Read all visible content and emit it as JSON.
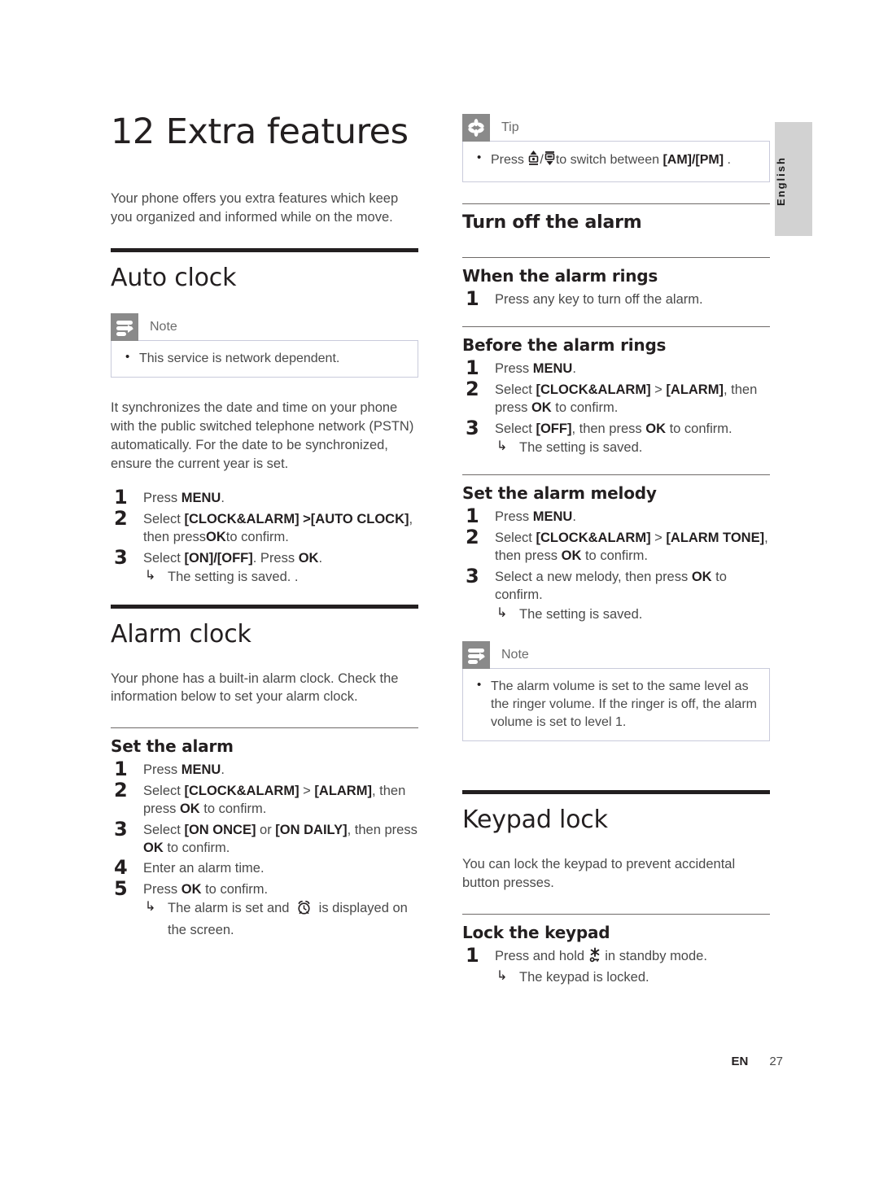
{
  "page": {
    "language_tab": "English",
    "footer_locale": "EN",
    "footer_page_number": "27"
  },
  "chapter": {
    "number": "12",
    "title": "Extra features",
    "intro": "Your phone offers you extra features which keep you organized and informed while on the move."
  },
  "left_column": {
    "auto_clock": {
      "heading": "Auto clock",
      "note": {
        "icon": "note-icon",
        "label": "Note",
        "items": [
          "This service is network dependent."
        ]
      },
      "paragraph": "It synchronizes the date and time on your phone with the public switched telephone network (PSTN) automatically. For the date to be synchronized, ensure the current year is set.",
      "steps": [
        {
          "parts": [
            {
              "t": "Press ",
              "b": false
            },
            {
              "t": "MENU",
              "b": true
            },
            {
              "t": ".",
              "b": false
            }
          ]
        },
        {
          "parts": [
            {
              "t": "Select ",
              "b": false
            },
            {
              "t": "[CLOCK&ALARM] >[AUTO CLOCK]",
              "b": true
            },
            {
              "t": ", then press",
              "b": false
            },
            {
              "t": "OK",
              "b": true
            },
            {
              "t": "to confirm.",
              "b": false
            }
          ]
        },
        {
          "parts": [
            {
              "t": "Select ",
              "b": false
            },
            {
              "t": "[ON]/[OFF]",
              "b": true
            },
            {
              "t": ". Press ",
              "b": false
            },
            {
              "t": "OK",
              "b": true
            },
            {
              "t": ".",
              "b": false
            }
          ],
          "result": "The setting is saved. ."
        }
      ]
    },
    "alarm_clock": {
      "heading": "Alarm clock",
      "paragraph": "Your phone has a built-in alarm clock. Check the information below to set your alarm clock.",
      "set_the_alarm": {
        "heading": "Set the alarm",
        "steps": [
          {
            "parts": [
              {
                "t": "Press ",
                "b": false
              },
              {
                "t": "MENU",
                "b": true
              },
              {
                "t": ".",
                "b": false
              }
            ]
          },
          {
            "parts": [
              {
                "t": "Select ",
                "b": false
              },
              {
                "t": "[CLOCK&ALARM]",
                "b": true
              },
              {
                "t": " > ",
                "b": false
              },
              {
                "t": "[ALARM]",
                "b": true
              },
              {
                "t": ", then press ",
                "b": false
              },
              {
                "t": "OK",
                "b": true
              },
              {
                "t": " to confirm.",
                "b": false
              }
            ]
          },
          {
            "parts": [
              {
                "t": "Select ",
                "b": false
              },
              {
                "t": "[ON ONCE]",
                "b": true
              },
              {
                "t": " or ",
                "b": false
              },
              {
                "t": "[ON DAILY]",
                "b": true
              },
              {
                "t": ", then press ",
                "b": false
              },
              {
                "t": "OK",
                "b": true
              },
              {
                "t": " to confirm.",
                "b": false
              }
            ]
          },
          {
            "parts": [
              {
                "t": "Enter an alarm time.",
                "b": false
              }
            ]
          },
          {
            "parts": [
              {
                "t": "Press ",
                "b": false
              },
              {
                "t": "OK",
                "b": true
              },
              {
                "t": " to confirm.",
                "b": false
              }
            ],
            "result_pre": "The alarm is set and",
            "result_icon": "alarm-clock-icon",
            "result_post": "is displayed on the screen."
          }
        ]
      }
    }
  },
  "right_column": {
    "tip": {
      "icon": "tip-asterisk-icon",
      "label": "Tip",
      "item_pre": "Press",
      "item_icon_up": "nav-up-key-icon",
      "item_sep": "/",
      "item_icon_down": "nav-down-key-icon",
      "item_mid": "to switch between ",
      "item_bold": "[AM]/[PM]",
      "item_post": " ."
    },
    "turn_off_the_alarm": {
      "heading": "Turn off the alarm",
      "when_the_alarm_rings": {
        "heading": "When the alarm rings",
        "steps": [
          {
            "parts": [
              {
                "t": "Press any key to turn off the alarm.",
                "b": false
              }
            ]
          }
        ]
      },
      "before_the_alarm_rings": {
        "heading": "Before the alarm rings",
        "steps": [
          {
            "parts": [
              {
                "t": "Press ",
                "b": false
              },
              {
                "t": "MENU",
                "b": true
              },
              {
                "t": ".",
                "b": false
              }
            ]
          },
          {
            "parts": [
              {
                "t": "Select ",
                "b": false
              },
              {
                "t": "[CLOCK&ALARM]",
                "b": true
              },
              {
                "t": " > ",
                "b": false
              },
              {
                "t": "[ALARM]",
                "b": true
              },
              {
                "t": ", then press ",
                "b": false
              },
              {
                "t": "OK",
                "b": true
              },
              {
                "t": " to confirm.",
                "b": false
              }
            ]
          },
          {
            "parts": [
              {
                "t": "Select ",
                "b": false
              },
              {
                "t": "[OFF]",
                "b": true
              },
              {
                "t": ", then press ",
                "b": false
              },
              {
                "t": "OK",
                "b": true
              },
              {
                "t": " to confirm.",
                "b": false
              }
            ],
            "result": "The setting is saved."
          }
        ]
      },
      "set_the_alarm_melody": {
        "heading": "Set the alarm melody",
        "steps": [
          {
            "parts": [
              {
                "t": "Press ",
                "b": false
              },
              {
                "t": "MENU",
                "b": true
              },
              {
                "t": ".",
                "b": false
              }
            ]
          },
          {
            "parts": [
              {
                "t": "Select ",
                "b": false
              },
              {
                "t": "[CLOCK&ALARM]",
                "b": true
              },
              {
                "t": " > ",
                "b": false
              },
              {
                "t": "[ALARM TONE]",
                "b": true
              },
              {
                "t": ", then press ",
                "b": false
              },
              {
                "t": "OK",
                "b": true
              },
              {
                "t": " to confirm.",
                "b": false
              }
            ]
          },
          {
            "parts": [
              {
                "t": "Select a new melody, then press ",
                "b": false
              },
              {
                "t": "OK",
                "b": true
              },
              {
                "t": " to confirm.",
                "b": false
              }
            ],
            "result": "The setting is saved."
          }
        ]
      },
      "note": {
        "icon": "note-icon",
        "label": "Note",
        "items": [
          "The alarm volume is set to the same level as the ringer volume. If the ringer is off, the alarm volume is set to level 1."
        ]
      }
    },
    "keypad_lock": {
      "heading": "Keypad lock",
      "paragraph": "You can lock the keypad to prevent accidental button presses.",
      "lock_the_keypad": {
        "heading": "Lock the keypad",
        "step_pre": "Press and hold",
        "step_icon": "star-key-icon",
        "step_post": "in standby mode.",
        "result": "The keypad is locked."
      }
    }
  }
}
